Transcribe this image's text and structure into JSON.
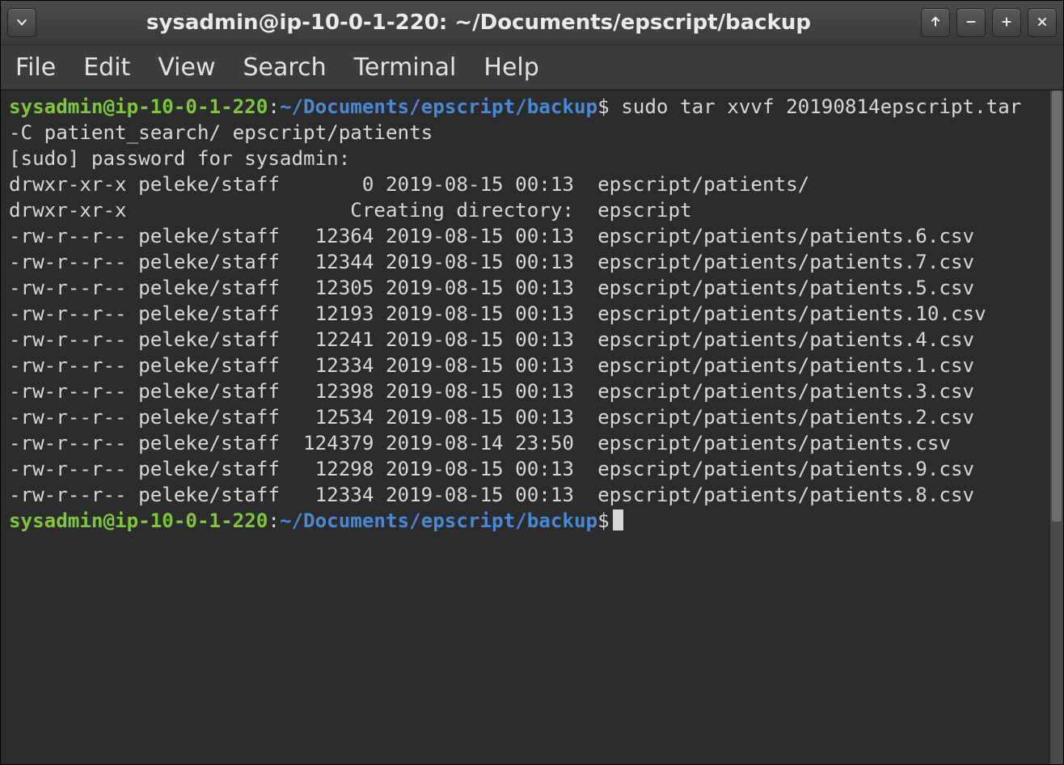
{
  "window": {
    "title": "sysadmin@ip-10-0-1-220: ~/Documents/epscript/backup"
  },
  "menu": [
    "File",
    "Edit",
    "View",
    "Search",
    "Terminal",
    "Help"
  ],
  "prompt": {
    "user_host": "sysadmin@ip-10-0-1-220",
    "sep1": ":",
    "path": "~/Documents/epscript/backup",
    "sigil": "$"
  },
  "command1": " sudo tar xvvf 20190814epscript.tar -C patient_search/ epscript/patients",
  "sudo_line": "[sudo] password for sysadmin:",
  "listing": [
    "drwxr-xr-x peleke/staff       0 2019-08-15 00:13  epscript/patients/",
    "drwxr-xr-x                   Creating directory:  epscript",
    "-rw-r--r-- peleke/staff   12364 2019-08-15 00:13  epscript/patients/patients.6.csv",
    "-rw-r--r-- peleke/staff   12344 2019-08-15 00:13  epscript/patients/patients.7.csv",
    "-rw-r--r-- peleke/staff   12305 2019-08-15 00:13  epscript/patients/patients.5.csv",
    "-rw-r--r-- peleke/staff   12193 2019-08-15 00:13  epscript/patients/patients.10.csv",
    "-rw-r--r-- peleke/staff   12241 2019-08-15 00:13  epscript/patients/patients.4.csv",
    "-rw-r--r-- peleke/staff   12334 2019-08-15 00:13  epscript/patients/patients.1.csv",
    "-rw-r--r-- peleke/staff   12398 2019-08-15 00:13  epscript/patients/patients.3.csv",
    "-rw-r--r-- peleke/staff   12534 2019-08-15 00:13  epscript/patients/patients.2.csv",
    "-rw-r--r-- peleke/staff  124379 2019-08-14 23:50  epscript/patients/patients.csv",
    "-rw-r--r-- peleke/staff   12298 2019-08-15 00:13  epscript/patients/patients.9.csv",
    "-rw-r--r-- peleke/staff   12334 2019-08-15 00:13  epscript/patients/patients.8.csv"
  ],
  "icons": {
    "dropdown": "chevron-down",
    "up": "arrow-up",
    "minimize": "minus",
    "maximize": "plus",
    "close": "x"
  }
}
